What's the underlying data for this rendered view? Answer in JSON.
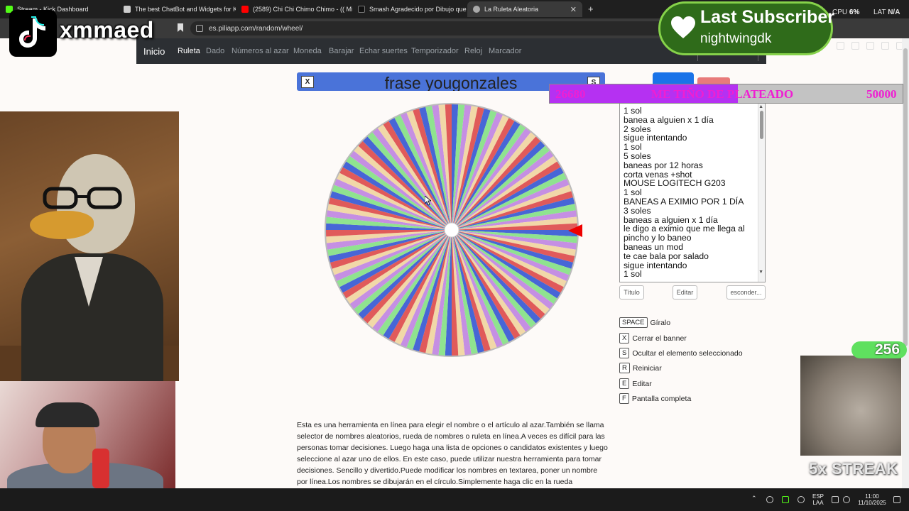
{
  "browser": {
    "tabs": [
      {
        "title": "Stream - Kick Dashboard",
        "favicon_color": "#53fc18"
      },
      {
        "title": "The best ChatBot and Widgets for Ki",
        "favicon_color": "#cccccc"
      },
      {
        "title": "(2589) Chi Chi Chimo Chimo - (( Mitc",
        "favicon_color": "#ff0000"
      },
      {
        "title": "Smash Agradecido por Dibujo que le",
        "favicon_color": "#111111"
      },
      {
        "title": "La Ruleta Aleatoria",
        "favicon_color": "#aaaaaa",
        "active": true
      }
    ],
    "url": "es.piliapp.com/random/wheel/",
    "cpu_label": "CPU",
    "cpu_value": "6%",
    "lat_label": "LAT",
    "lat_value": "N/A"
  },
  "site_nav": {
    "brand": "Inicio",
    "items": [
      "Ruleta",
      "Dado",
      "Números al azar",
      "Moneda",
      "Barajar",
      "Echar suertes",
      "Temporizador",
      "Reloj",
      "Marcador"
    ],
    "active": "Ruleta"
  },
  "wheel": {
    "title": "frase yougonzales",
    "close_key": "X",
    "hide_key": "S",
    "segment_colors": [
      "#4766d6",
      "#e05a5a",
      "#f1d8a8",
      "#c58fe3",
      "#8fe38f"
    ]
  },
  "options": {
    "items": [
      "1 sol",
      "banea a alguien x 1 día",
      "2 soles",
      "sigue intentando",
      "1 sol",
      "5 soles",
      "baneas por 12 horas",
      "corta venas +shot",
      "MOUSE LOGITECH G203",
      "1 sol",
      "BANEAS A EXIMIO POR 1 DÍA",
      "3 soles",
      "baneas a alguien x 1 día",
      "le digo a eximio que me llega al",
      "pincho y lo baneo",
      "baneas un mod",
      "te cae bala por salado",
      "sigue intentando",
      "1 sol"
    ],
    "buttons": {
      "title": "Título",
      "edit": "Editar",
      "hide": "esconder..."
    }
  },
  "shortcuts": [
    {
      "key": "SPACE",
      "label": "Gíralo"
    },
    {
      "key": "X",
      "label": "Cerrar el banner"
    },
    {
      "key": "S",
      "label": "Ocultar el elemento seleccionado"
    },
    {
      "key": "R",
      "label": "Reiniciar"
    },
    {
      "key": "E",
      "label": "Editar"
    },
    {
      "key": "F",
      "label": "Pantalla completa"
    }
  ],
  "description": "Esta es una herramienta en línea para elegir el nombre o el artículo al azar.También se llama selector de nombres aleatorios, rueda de nombres o ruleta en línea.A veces es difícil para las personas tomar decisiones. Luego haga una lista de opciones o candidatos existentes y luego seleccione al azar uno de ellos. En este caso, puede utilizar nuestra herramienta para tomar decisiones. Sencillo y divertido.Puede modificar los nombres en textarea, poner un nombre por línea.Los nombres se dibujarán en el círculo.Simplemente haga clic en la rueda",
  "overlay": {
    "streamer": "xmmaed",
    "sub_title": "Last Subscriber",
    "sub_name": "nightwingdk",
    "goal_current": "26680",
    "goal_text": "ME TIÑO DE PLATEADO",
    "goal_max": "50000",
    "goal_progress": 0.5336,
    "cat_count": "256",
    "streak": "5x STREAK"
  },
  "taskbar": {
    "lang": "ESP",
    "lang2": "LAA",
    "time": "11:00",
    "date": "11/10/2025"
  }
}
